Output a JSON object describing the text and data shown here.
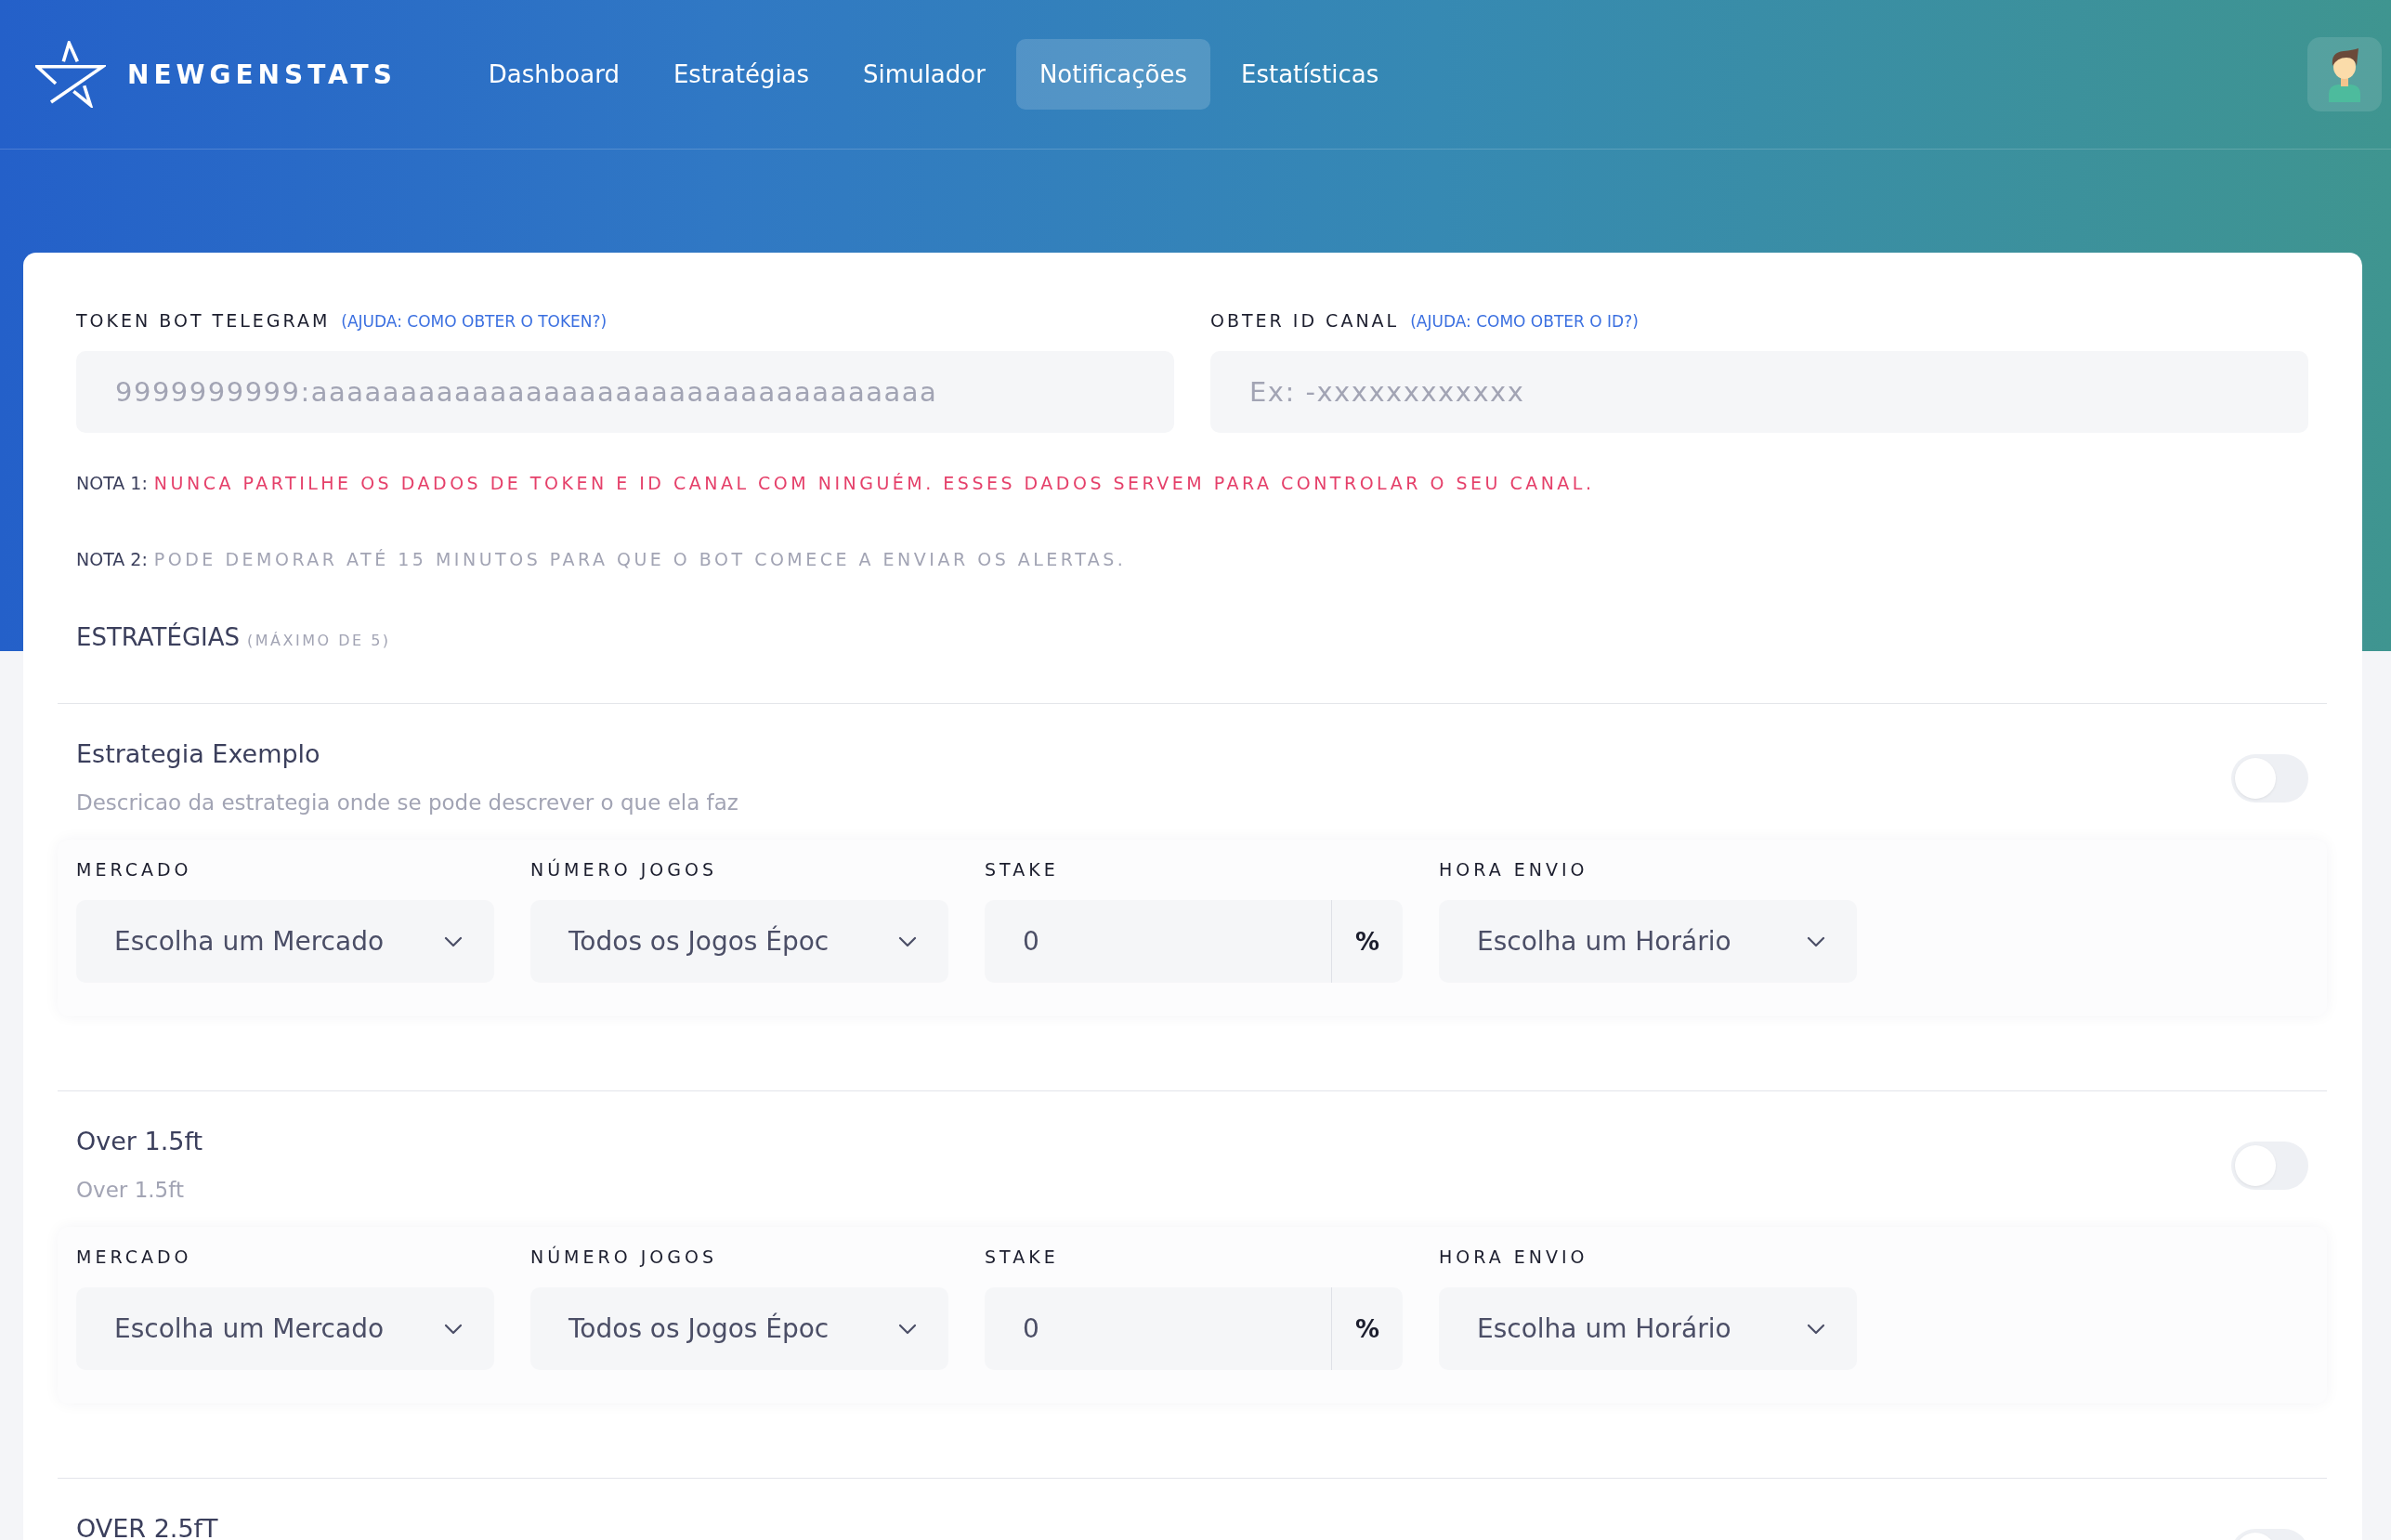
{
  "brand": {
    "name": "NEWGENSTATS"
  },
  "nav": [
    {
      "label": "Dashboard",
      "selected": false
    },
    {
      "label": "Estratégias",
      "selected": false
    },
    {
      "label": "Simulador",
      "selected": false
    },
    {
      "label": "Notificações",
      "selected": true
    },
    {
      "label": "Estatísticas",
      "selected": false
    }
  ],
  "settings": {
    "fields": [
      {
        "label": "TOKEN BOT TELEGRAM",
        "help": "(AJUDA: COMO OBTER O TOKEN?)",
        "placeholder": "9999999999:aaaaaaaaaaaaaaaaaaaaaaaaaaaaaaaaaaa"
      },
      {
        "label": "OBTER ID CANAL",
        "help": "(AJUDA: COMO OBTER O ID?)",
        "placeholder": "Ex: -xxxxxxxxxxxx"
      }
    ],
    "notes": [
      {
        "kind": "warning",
        "label": "NOTA 1:",
        "text": "NUNCA PARTILHE OS DADOS DE TOKEN E ID CANAL COM NINGUÉM. ESSES DADOS SERVEM PARA CONTROLAR O SEU CANAL."
      },
      {
        "kind": "info",
        "label": "NOTA 2:",
        "text": "PODE DEMORAR ATÉ 15 MINUTOS PARA QUE O BOT COMECE A ENVIAR OS ALERTAS."
      }
    ]
  },
  "strategies_heading": {
    "title": "ESTRATÉGIAS",
    "hint": "(MÁXIMO DE 5)"
  },
  "strategies": [
    {
      "title": "Estrategia Exemplo",
      "description": "Descricao da estrategia onde se pode descrever o que ela faz",
      "enabled": false,
      "fields": [
        {
          "kind": "select",
          "label": "MERCADO",
          "value": "Escolha um Mercado"
        },
        {
          "kind": "select",
          "label": "NÚMERO JOGOS",
          "value": "Todos os Jogos Époc"
        },
        {
          "kind": "number",
          "label": "STAKE",
          "value": "0",
          "suffix": "%"
        },
        {
          "kind": "select",
          "label": "HORA ENVIO",
          "value": "Escolha um Horário"
        }
      ]
    },
    {
      "title": "Over 1.5ft",
      "description": "Over 1.5ft",
      "enabled": false,
      "fields": [
        {
          "kind": "select",
          "label": "MERCADO",
          "value": "Escolha um Mercado"
        },
        {
          "kind": "select",
          "label": "NÚMERO JOGOS",
          "value": "Todos os Jogos Époc"
        },
        {
          "kind": "number",
          "label": "STAKE",
          "value": "0",
          "suffix": "%"
        },
        {
          "kind": "select",
          "label": "HORA ENVIO",
          "value": "Escolha um Horário"
        }
      ]
    },
    {
      "title": "OVER 2.5fT",
      "enabled": false
    }
  ]
}
